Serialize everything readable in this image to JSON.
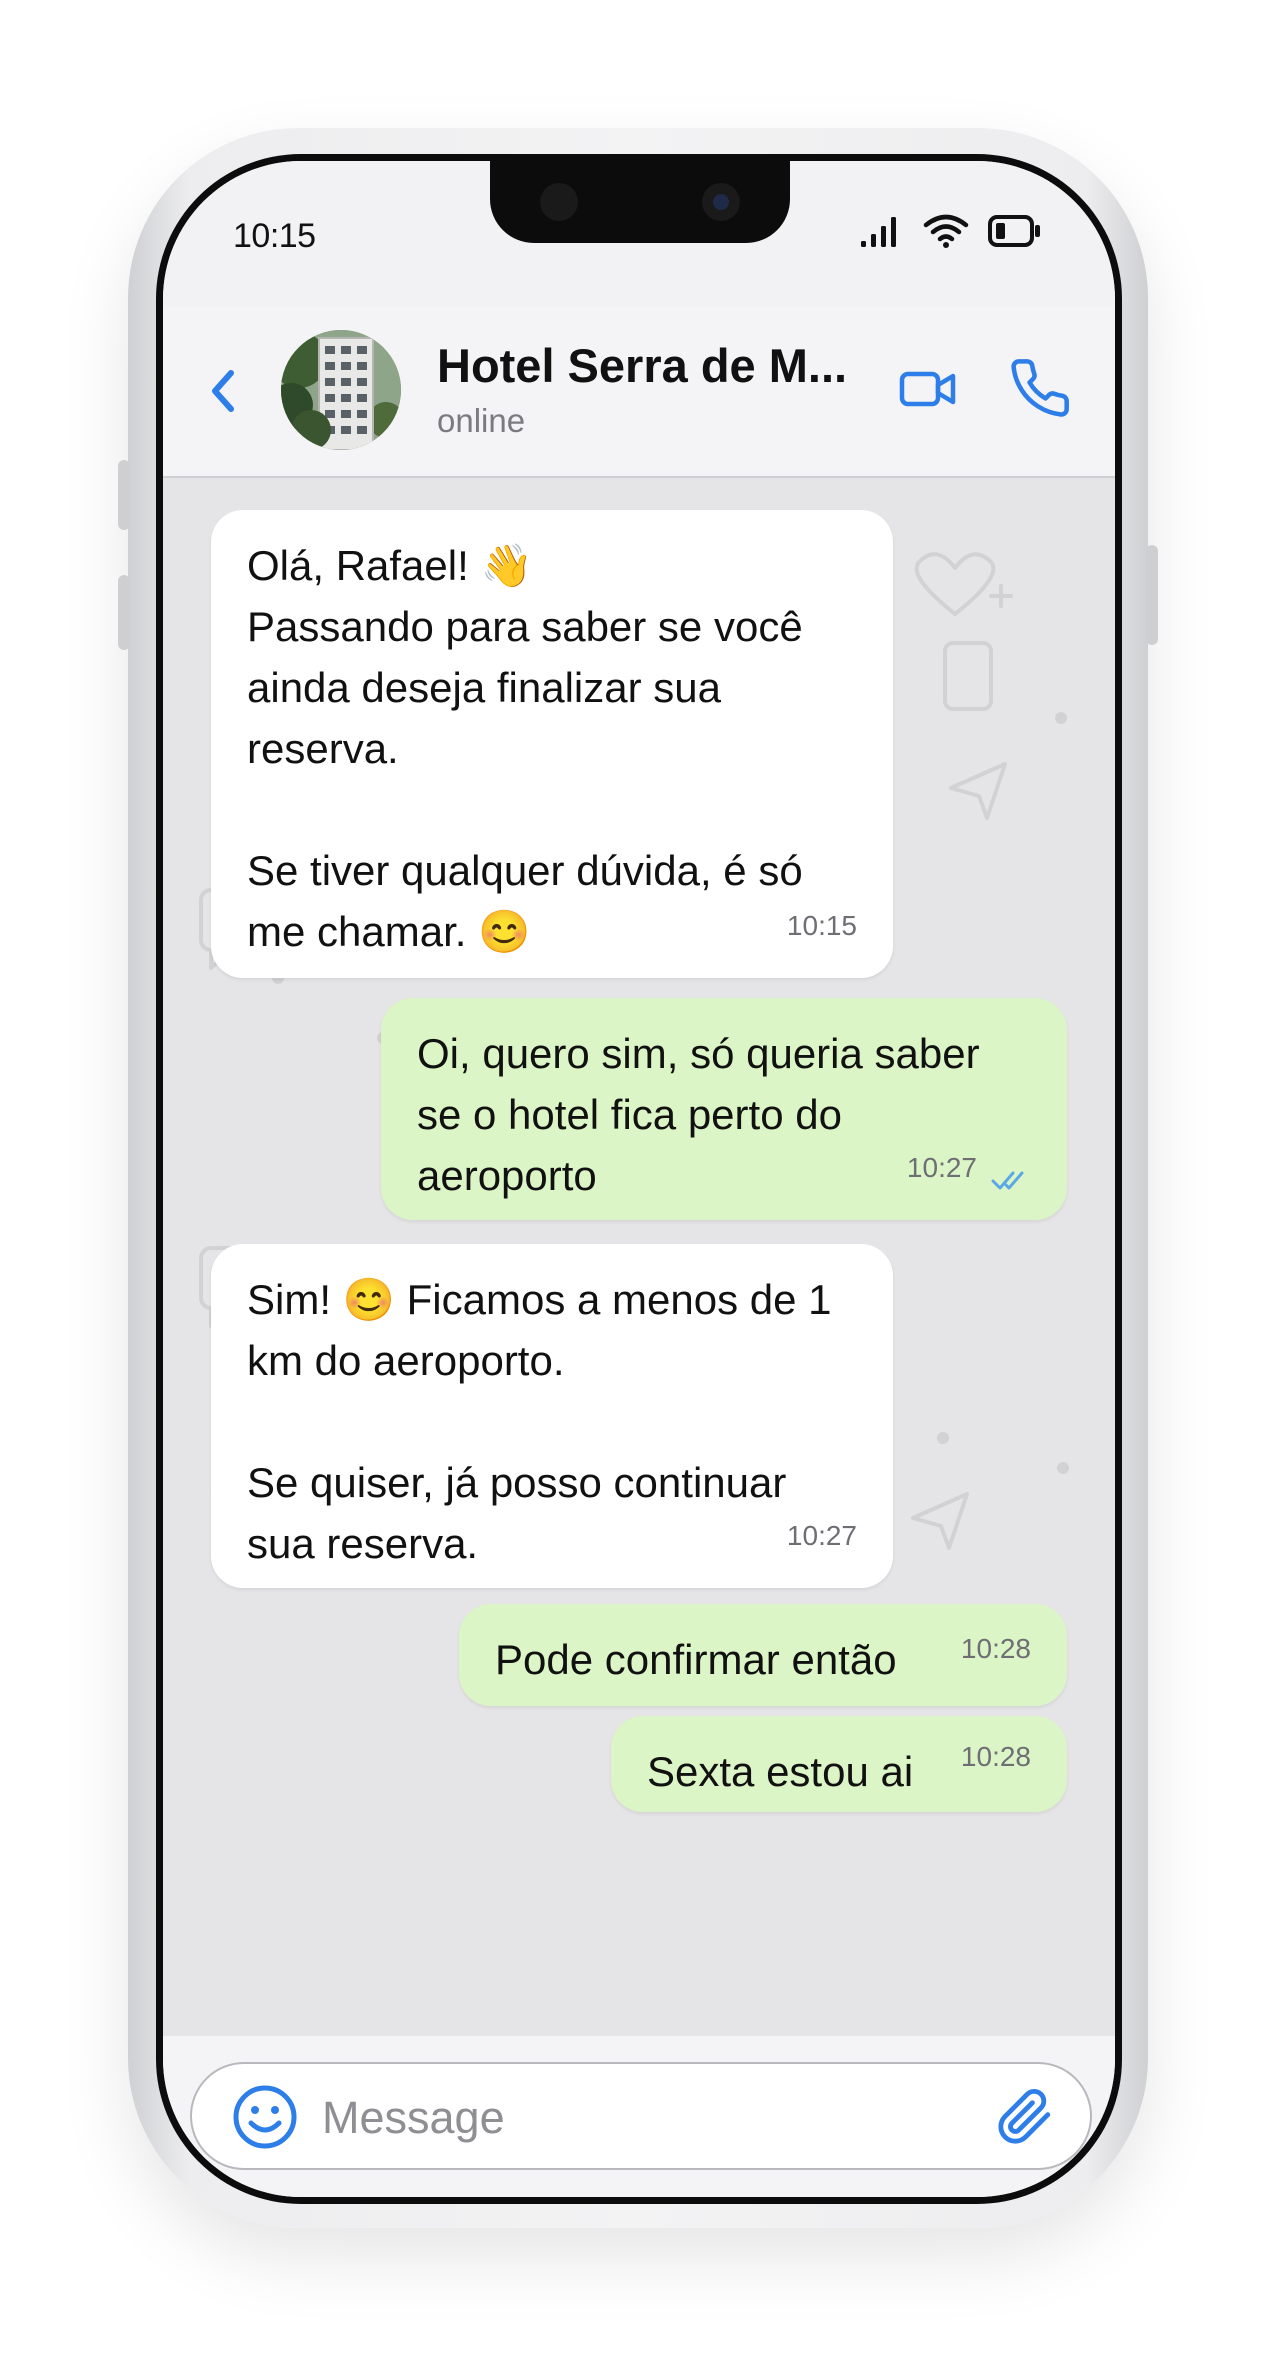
{
  "status_bar": {
    "time": "10:15"
  },
  "header": {
    "contact_name": "Hotel Serra de M...",
    "status": "online"
  },
  "messages": [
    {
      "direction": "in",
      "text": "Olá, Rafael! 👋\nPassando para saber se você ainda deseja finalizar sua reserva.\n\nSe tiver qualquer dúvida, é só me chamar. 😊",
      "time": "10:15"
    },
    {
      "direction": "out",
      "text": "Oi, quero sim, só queria saber se o hotel fica perto do aeroporto",
      "time": "10:27",
      "read": true
    },
    {
      "direction": "in",
      "text": "Sim! 😊 Ficamos a menos de 1 km do aeroporto.\n\nSe quiser, já posso continuar sua reserva.",
      "time": "10:27"
    },
    {
      "direction": "out",
      "text": "Pode confirmar então",
      "time": "10:28"
    },
    {
      "direction": "out",
      "text": "Sexta estou ai",
      "time": "10:28"
    }
  ],
  "input": {
    "placeholder": "Message"
  },
  "icons": {
    "back": "chevron-left-icon",
    "video": "video-camera-icon",
    "call": "phone-icon",
    "emoji": "smiley-icon",
    "attach": "paperclip-icon",
    "read_receipt": "double-check-icon"
  },
  "colors": {
    "accent": "#2d7ee8",
    "outgoing_bubble": "#dcf5c6",
    "incoming_bubble": "#ffffff",
    "chat_background": "#e5e5e7"
  }
}
